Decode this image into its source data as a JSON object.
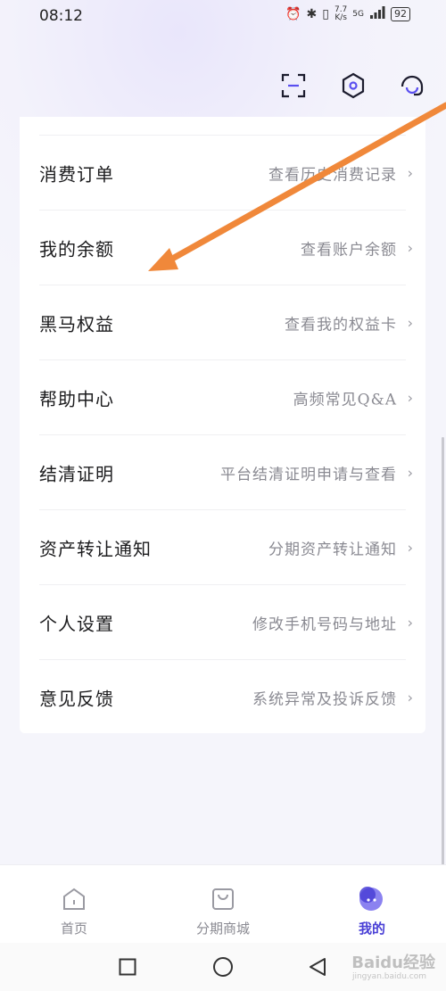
{
  "status_bar": {
    "time": "08:12",
    "net_speed_top": "7.7",
    "net_speed_bottom": "K/s",
    "signal": "5G",
    "battery": "92"
  },
  "header_icons": [
    "scan-icon",
    "settings-icon",
    "customer-service-icon"
  ],
  "menu": {
    "items": [
      {
        "label": "消费订单",
        "sub": "查看历史消费记录"
      },
      {
        "label": "我的余额",
        "sub": "查看账户余额"
      },
      {
        "label": "黑马权益",
        "sub": "查看我的权益卡"
      },
      {
        "label": "帮助中心",
        "sub": "高频常见Q&A"
      },
      {
        "label": "结清证明",
        "sub": "平台结清证明申请与查看"
      },
      {
        "label": "资产转让通知",
        "sub": "分期资产转让通知"
      },
      {
        "label": "个人设置",
        "sub": "修改手机号码与地址"
      },
      {
        "label": "意见反馈",
        "sub": "系统异常及投诉反馈"
      }
    ],
    "chevron": "›"
  },
  "tabs": [
    {
      "label": "首页",
      "icon": "home-icon",
      "active": false
    },
    {
      "label": "分期商城",
      "icon": "shopping-bag-icon",
      "active": false
    },
    {
      "label": "我的",
      "icon": "profile-icon",
      "active": true
    }
  ],
  "colors": {
    "accent": "#4a40d6",
    "annotation_arrow": "#f0883a"
  },
  "watermark": {
    "brand": "Baidu经验",
    "url": "jingyan.baidu.com"
  }
}
